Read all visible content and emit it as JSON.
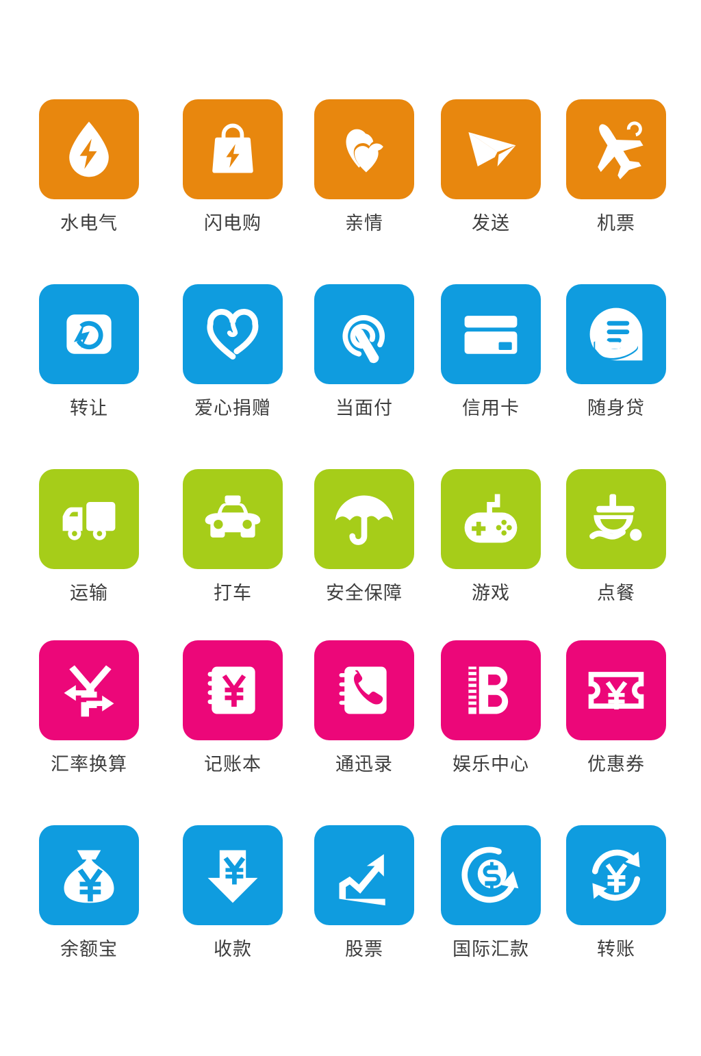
{
  "page": {
    "background": "#ffffff",
    "label_color": "#3d3d3d",
    "columns": 5,
    "rows": 5
  },
  "palette": {
    "orange": "#E8870E",
    "blue": "#0F9CDF",
    "green": "#A6CD19",
    "pink": "#EC0779",
    "glyph": "#FFFFFF"
  },
  "rows": [
    {
      "color_name": "orange",
      "color": "#E8870E",
      "items": [
        {
          "label": "水电气",
          "icon": "water-electric-gas-icon"
        },
        {
          "label": "闪电购",
          "icon": "flash-shopping-bag-icon"
        },
        {
          "label": "亲情",
          "icon": "two-hearts-icon"
        },
        {
          "label": "发送",
          "icon": "paper-plane-send-icon"
        },
        {
          "label": "机票",
          "icon": "airplane-ticket-icon"
        }
      ]
    },
    {
      "color_name": "blue",
      "color": "#0F9CDF",
      "items": [
        {
          "label": "转让",
          "icon": "transfer-ownership-icon"
        },
        {
          "label": "爱心捐赠",
          "icon": "heart-donation-icon"
        },
        {
          "label": "当面付",
          "icon": "tap-to-pay-icon"
        },
        {
          "label": "信用卡",
          "icon": "credit-card-icon"
        },
        {
          "label": "随身贷",
          "icon": "hand-loan-icon"
        }
      ]
    },
    {
      "color_name": "green",
      "color": "#A6CD19",
      "items": [
        {
          "label": "运输",
          "icon": "delivery-truck-icon"
        },
        {
          "label": "打车",
          "icon": "taxi-icon"
        },
        {
          "label": "安全保障",
          "icon": "umbrella-protection-icon"
        },
        {
          "label": "游戏",
          "icon": "game-controller-icon"
        },
        {
          "label": "点餐",
          "icon": "order-food-icon"
        }
      ]
    },
    {
      "color_name": "pink",
      "color": "#EC0779",
      "items": [
        {
          "label": "汇率换算",
          "icon": "exchange-rate-yen-arrows-icon"
        },
        {
          "label": "记账本",
          "icon": "account-book-yen-icon"
        },
        {
          "label": "通迅录",
          "icon": "phone-contacts-book-icon"
        },
        {
          "label": "娱乐中心",
          "icon": "entertainment-b-icon"
        },
        {
          "label": "优惠券",
          "icon": "yen-coupon-ticket-icon"
        }
      ]
    },
    {
      "color_name": "blue",
      "color": "#0F9CDF",
      "items": [
        {
          "label": "余额宝",
          "icon": "money-bag-yen-icon"
        },
        {
          "label": "收款",
          "icon": "receive-payment-down-arrow-icon"
        },
        {
          "label": "股票",
          "icon": "stock-chart-up-icon"
        },
        {
          "label": "国际汇款",
          "icon": "international-remittance-dollar-icon"
        },
        {
          "label": "转账",
          "icon": "transfer-yen-refresh-icon"
        }
      ]
    }
  ]
}
